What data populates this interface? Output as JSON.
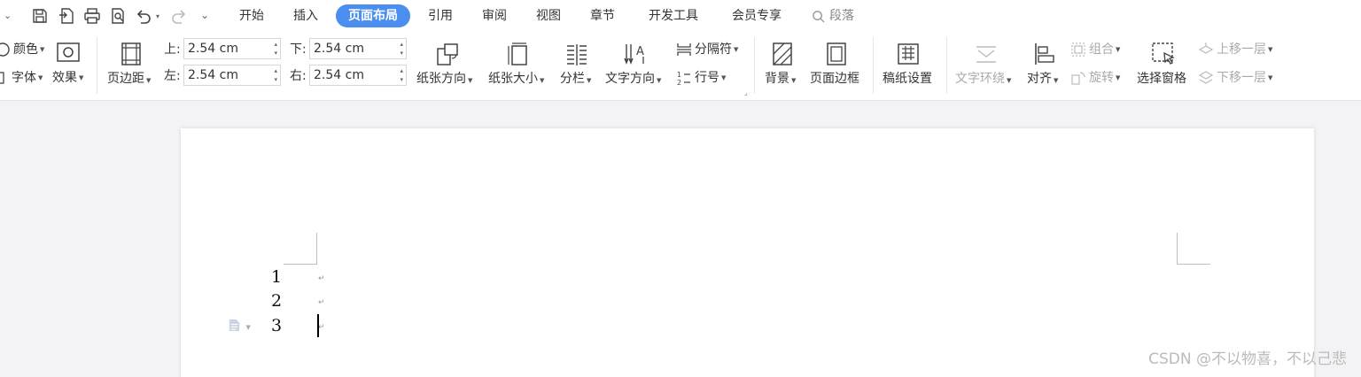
{
  "tabs": [
    {
      "label": "开始"
    },
    {
      "label": "插入"
    },
    {
      "label": "页面布局",
      "active": true
    },
    {
      "label": "引用"
    },
    {
      "label": "审阅"
    },
    {
      "label": "视图"
    },
    {
      "label": "章节"
    },
    {
      "label": "开发工具"
    },
    {
      "label": "会员专享"
    }
  ],
  "search_label": "段落",
  "theme": {
    "color_label": "颜色",
    "font_label": "字体",
    "effects_label": "效果"
  },
  "margins": {
    "button_label": "页边距",
    "top_label": "上:",
    "top_value": "2.54 cm",
    "bottom_label": "下:",
    "bottom_value": "2.54 cm",
    "left_label": "左:",
    "left_value": "2.54 cm",
    "right_label": "右:",
    "right_value": "2.54 cm"
  },
  "page_setup": {
    "orientation": "纸张方向",
    "size": "纸张大小",
    "columns": "分栏",
    "text_direction": "文字方向",
    "breaks": "分隔符",
    "line_numbers": "行号"
  },
  "page_bg": {
    "background": "背景",
    "borders": "页面边框"
  },
  "draft": {
    "label": "稿纸设置"
  },
  "arrange": {
    "wrap": "文字环绕",
    "align": "对齐",
    "group": "组合",
    "rotate": "旋转",
    "selection_pane": "选择窗格",
    "bring_forward": "上移一层",
    "send_backward": "下移一层"
  },
  "document": {
    "line_numbers": [
      "1",
      "2",
      "3"
    ]
  },
  "watermark": "CSDN @不以物喜，不以己悲",
  "colors": {
    "accent": "#4a8ef0",
    "background": "#f3f3f5",
    "page": "#ffffff"
  }
}
